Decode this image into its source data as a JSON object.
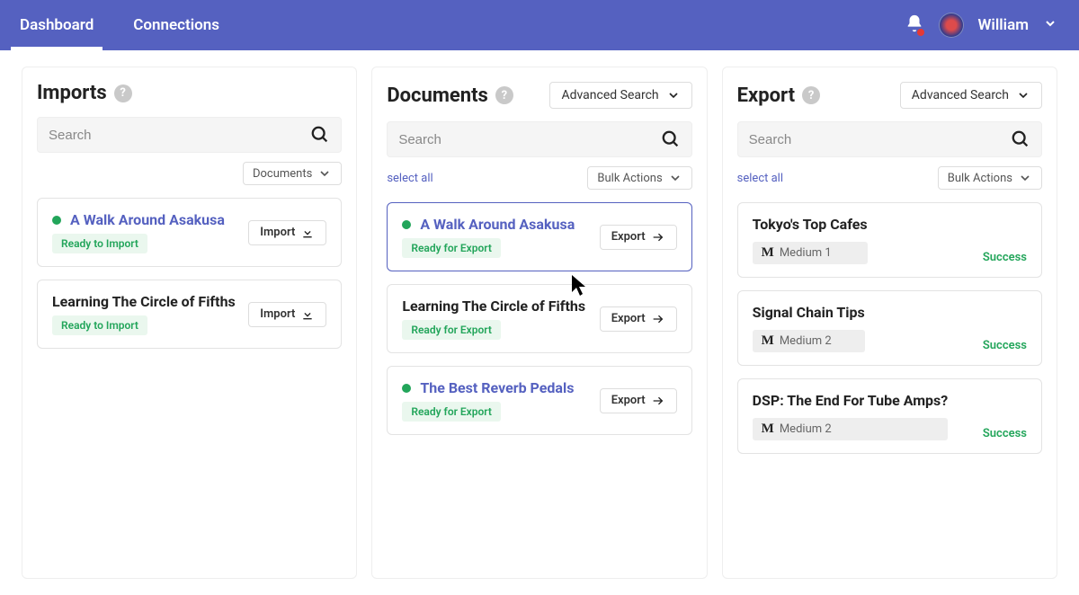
{
  "header": {
    "tabs": {
      "dashboard": "Dashboard",
      "connections": "Connections"
    },
    "username": "William"
  },
  "common": {
    "search_placeholder": "Search",
    "advanced_search": "Advanced Search",
    "select_all": "select all",
    "bulk_actions": "Bulk Actions",
    "help_glyph": "?"
  },
  "imports": {
    "title": "Imports",
    "filter": "Documents",
    "action_label": "Import",
    "items": [
      {
        "title": "A Walk Around Asakusa",
        "status": "Ready to Import",
        "linked": true
      },
      {
        "title": "Learning The Circle of Fifths",
        "status": "Ready to Import",
        "linked": false
      }
    ]
  },
  "documents": {
    "title": "Documents",
    "action_label": "Export",
    "items": [
      {
        "title": "A Walk Around Asakusa",
        "status": "Ready for Export",
        "linked": true,
        "selected": true
      },
      {
        "title": "Learning The Circle of Fifths",
        "status": "Ready for Export",
        "linked": false,
        "selected": false
      },
      {
        "title": "The Best Reverb Pedals",
        "status": "Ready for Export",
        "linked": true,
        "selected": false
      }
    ]
  },
  "exports": {
    "title": "Export",
    "items": [
      {
        "title": "Tokyo's Top Cafes",
        "destination": "Medium 1",
        "result": "Success"
      },
      {
        "title": "Signal Chain Tips",
        "destination": "Medium 2",
        "result": "Success"
      },
      {
        "title": "DSP: The End For Tube Amps?",
        "destination": "Medium 2",
        "result": "Success"
      }
    ]
  },
  "colors": {
    "brand": "#5561c0",
    "success": "#22a55a"
  }
}
